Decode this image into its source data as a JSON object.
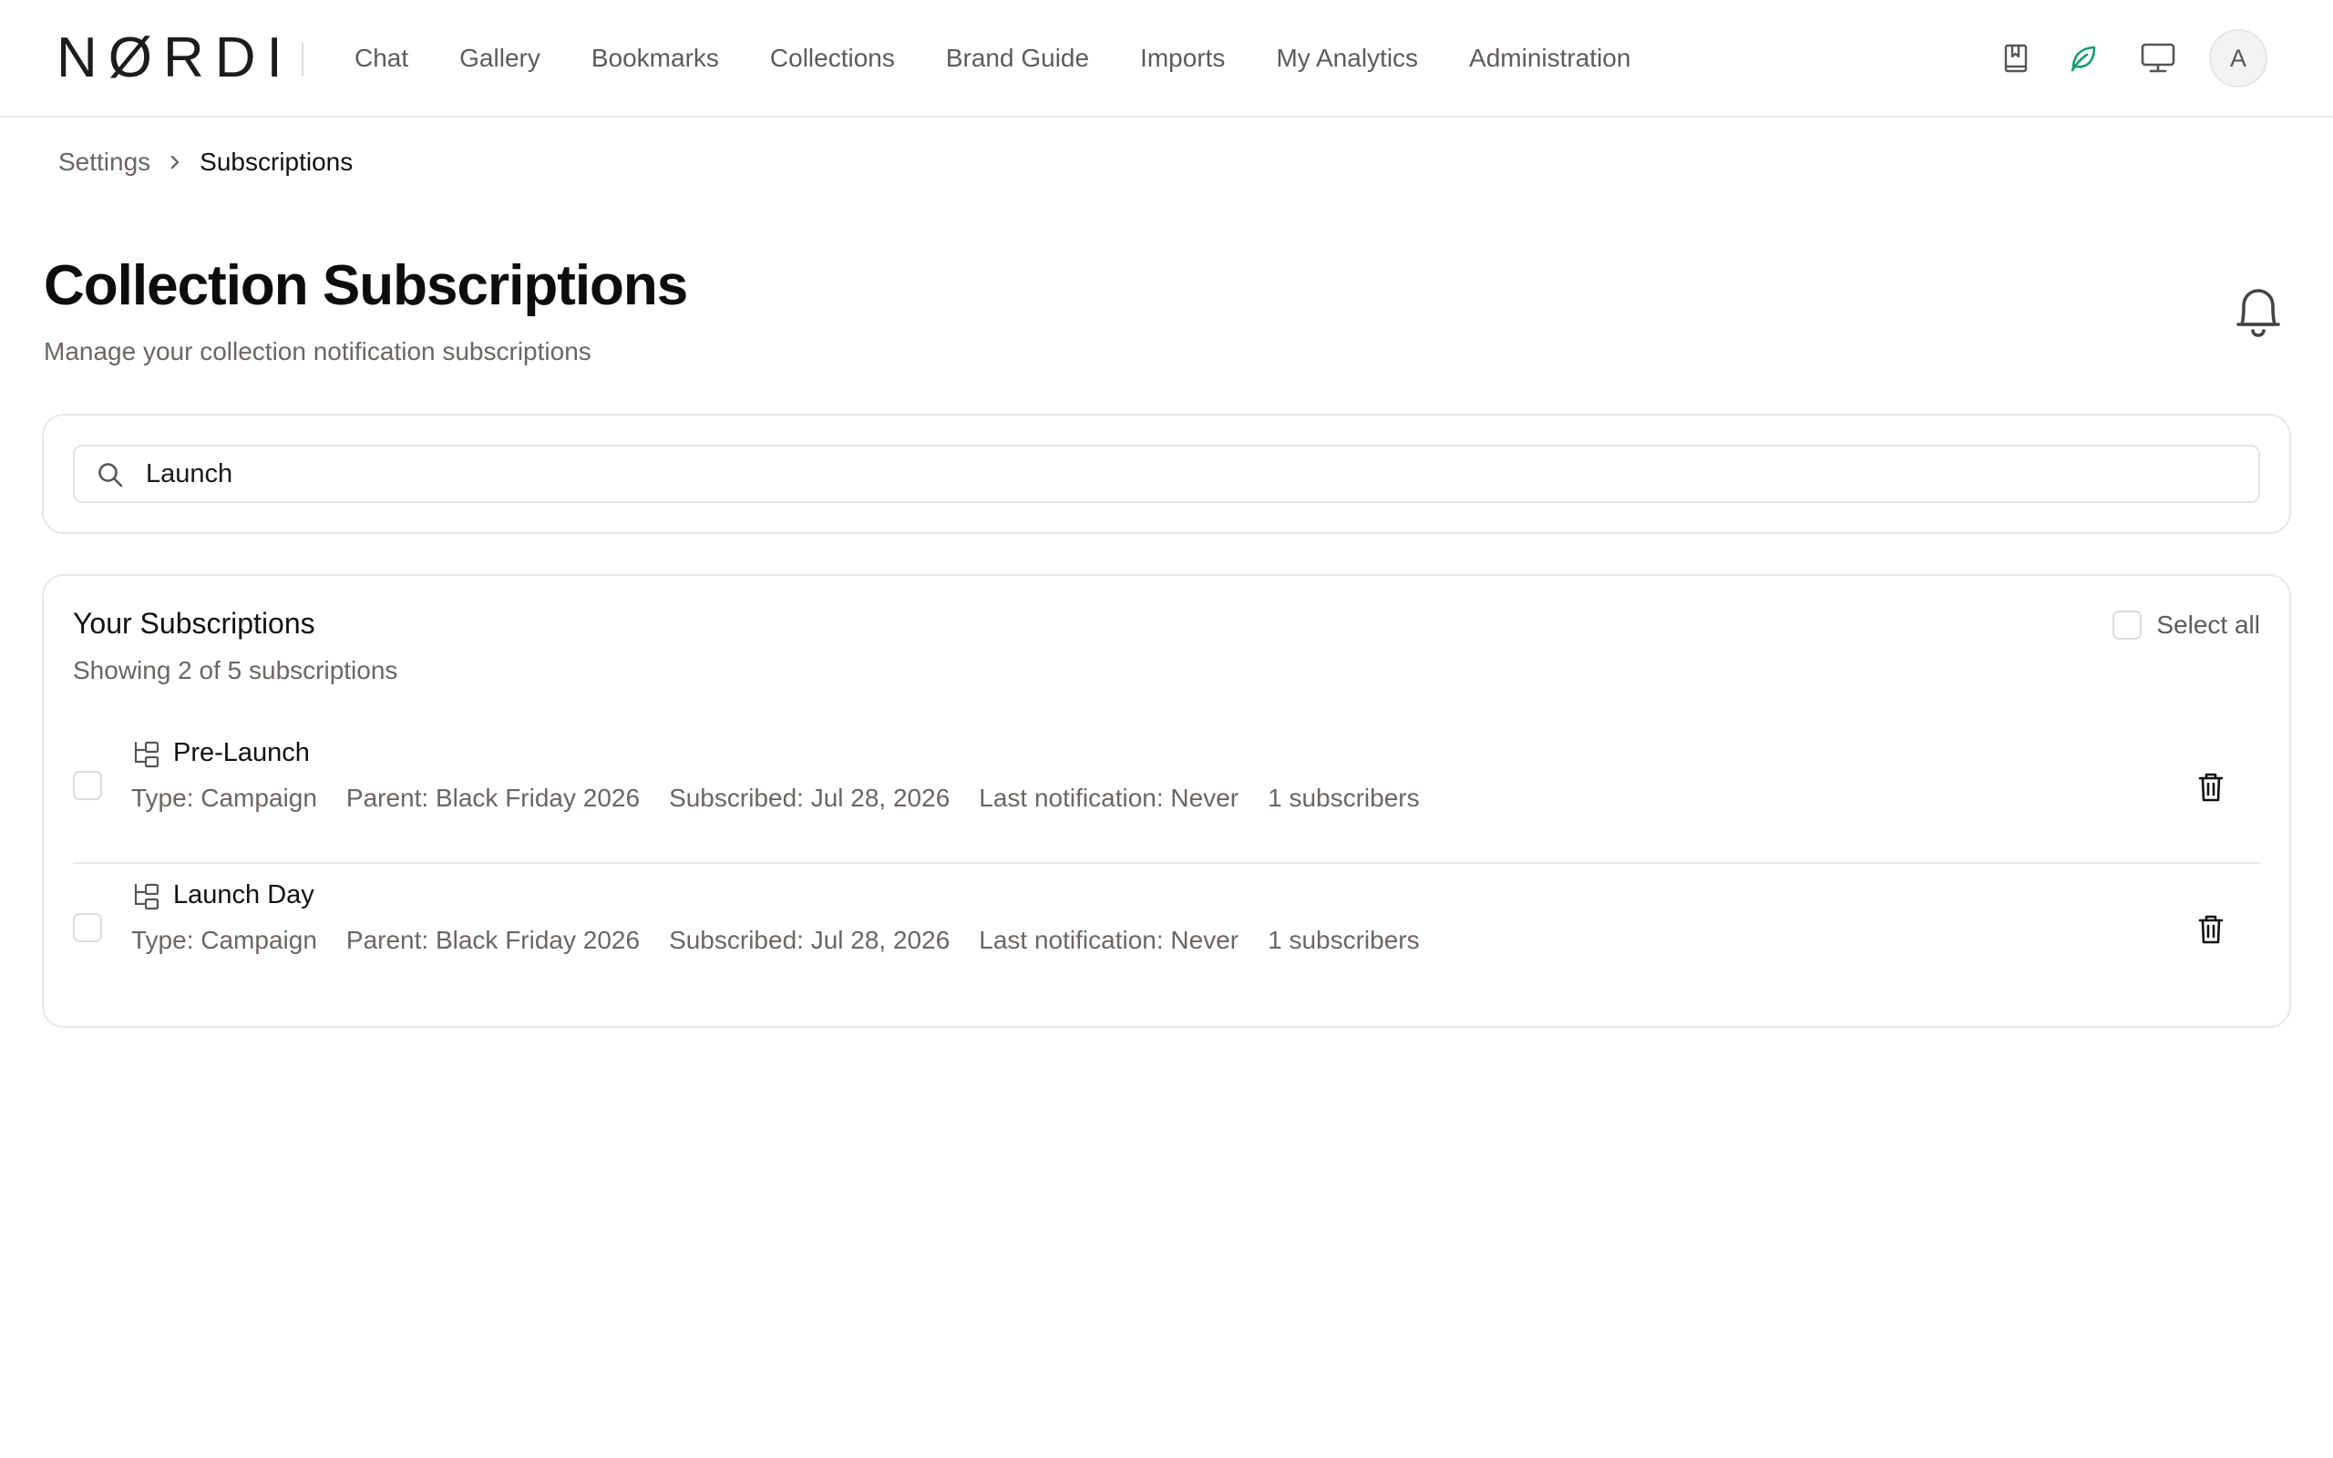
{
  "brand": {
    "logo_text": "NØRDI"
  },
  "nav": {
    "items": [
      {
        "label": "Chat"
      },
      {
        "label": "Gallery"
      },
      {
        "label": "Bookmarks"
      },
      {
        "label": "Collections"
      },
      {
        "label": "Brand Guide"
      },
      {
        "label": "Imports"
      },
      {
        "label": "My Analytics"
      },
      {
        "label": "Administration"
      }
    ]
  },
  "header_icons": {
    "bookmark": "bookmark-book-icon",
    "leaf": "leaf-icon",
    "monitor": "monitor-icon",
    "avatar_initial": "A",
    "leaf_color": "#159a6a"
  },
  "breadcrumb": {
    "parent": "Settings",
    "current": "Subscriptions"
  },
  "page": {
    "title": "Collection Subscriptions",
    "subtitle": "Manage your collection notification subscriptions"
  },
  "search": {
    "value": "Launch",
    "placeholder": ""
  },
  "subscriptions": {
    "title": "Your Subscriptions",
    "count_text": "Showing 2 of 5 subscriptions",
    "select_all_label": "Select all",
    "rows": [
      {
        "name": "Pre-Launch",
        "type": "Type: Campaign",
        "parent": "Parent: Black Friday 2026",
        "subscribed": "Subscribed: Jul 28, 2026",
        "last_notification": "Last notification: Never",
        "subscribers": "1 subscribers"
      },
      {
        "name": "Launch Day",
        "type": "Type: Campaign",
        "parent": "Parent: Black Friday 2026",
        "subscribed": "Subscribed: Jul 28, 2026",
        "last_notification": "Last notification: Never",
        "subscribers": "1 subscribers"
      }
    ]
  }
}
